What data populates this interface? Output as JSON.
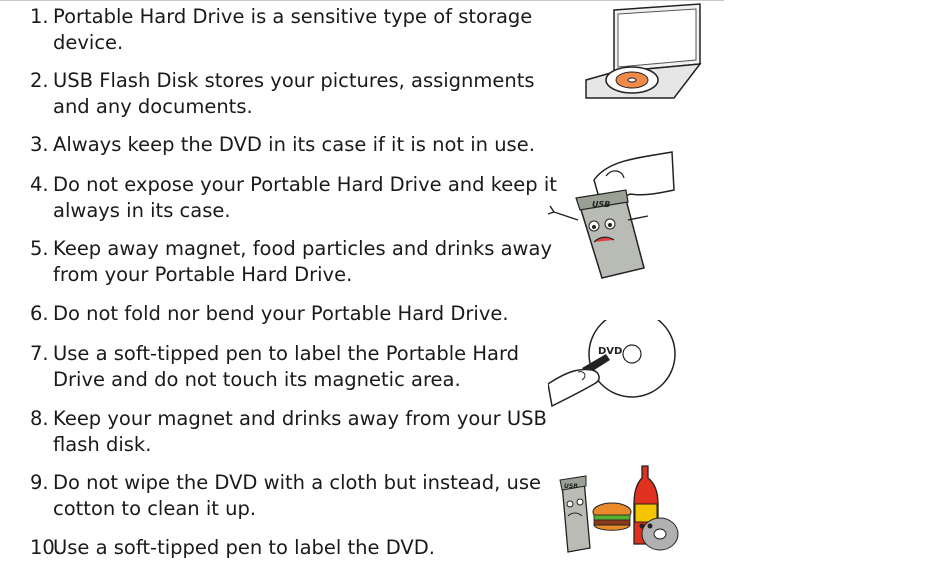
{
  "items": [
    {
      "number": "1.",
      "text": "Portable Hard Drive  is a sensitive type of storage device."
    },
    {
      "number": "2.",
      "text": "USB Flash Disk stores your pictures, assignments and any documents."
    },
    {
      "number": "3.",
      "text": "Always keep the DVD in its case if it is not in use."
    },
    {
      "number": "4.",
      "text": "Do not expose your Portable Hard Drive and keep it always in its case."
    },
    {
      "number": "5.",
      "text": "Keep away magnet, food particles and drinks away from your Portable Hard Drive."
    },
    {
      "number": "6.",
      "text": "Do not fold nor bend your Portable Hard Drive."
    },
    {
      "number": "7.",
      "text": "Use a soft-tipped pen to label the Portable Hard Drive and do not touch its magnetic area."
    },
    {
      "number": "8.",
      "text": "Keep your magnet and drinks away from your USB flash disk."
    },
    {
      "number": "9.",
      "text": "Do not wipe the DVD with a cloth but instead, use cotton to clean it up."
    },
    {
      "number": "10.",
      "text": "Use a soft-tipped pen to label the DVD."
    }
  ],
  "illustrations": {
    "usb_label": "USB",
    "dvd_label": "DVD",
    "usb_small_label": "USB"
  },
  "colors": {
    "text": "#1a1a1a",
    "disc_orange": "#f08a4b",
    "bottle_red": "#e0301e",
    "bottle_yellow": "#f5c400",
    "burger_orange": "#e8892a",
    "burger_green": "#58b030",
    "usb_gray": "#b8bcb4"
  }
}
